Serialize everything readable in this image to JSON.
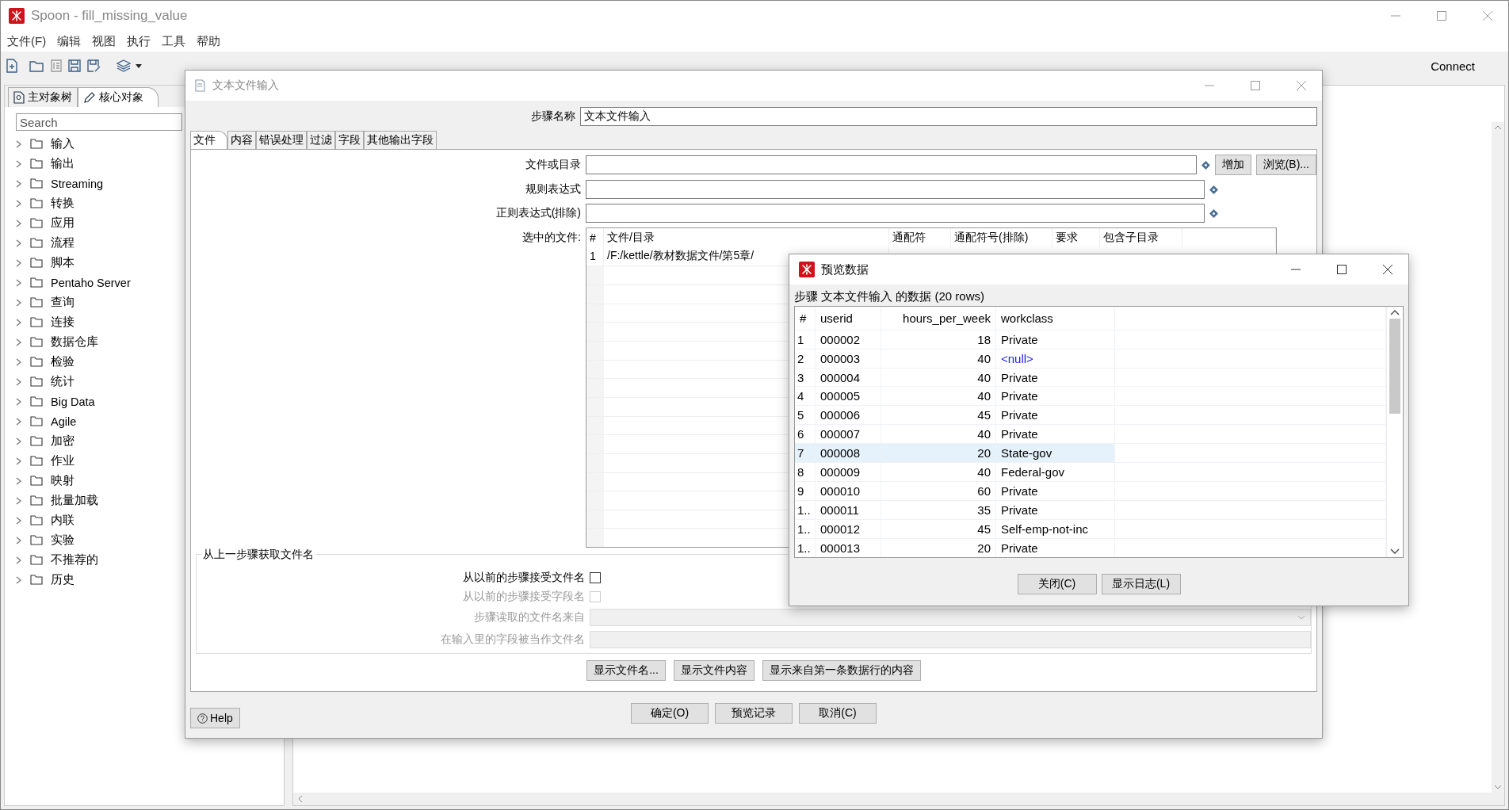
{
  "window": {
    "title": "Spoon - fill_missing_value"
  },
  "menu": [
    "文件(F)",
    "编辑",
    "视图",
    "执行",
    "工具",
    "帮助"
  ],
  "toolbar": {
    "connect": "Connect"
  },
  "left_panel": {
    "tabs": [
      {
        "label": "主对象树",
        "selected": false
      },
      {
        "label": "核心对象",
        "selected": true
      }
    ],
    "search": {
      "placeholder": "Search"
    },
    "tree": [
      {
        "label": "输入",
        "expanded": false
      },
      {
        "label": "输出",
        "expanded": false
      },
      {
        "label": "Streaming",
        "expanded": false
      },
      {
        "label": "转换",
        "expanded": false
      },
      {
        "label": "应用",
        "expanded": false
      },
      {
        "label": "流程",
        "expanded": false
      },
      {
        "label": "脚本",
        "expanded": false
      },
      {
        "label": "Pentaho Server",
        "expanded": false
      },
      {
        "label": "查询",
        "expanded": false
      },
      {
        "label": "连接",
        "expanded": false
      },
      {
        "label": "数据仓库",
        "expanded": false
      },
      {
        "label": "检验",
        "expanded": false
      },
      {
        "label": "统计",
        "expanded": false
      },
      {
        "label": "Big Data",
        "expanded": false
      },
      {
        "label": "Agile",
        "expanded": false
      },
      {
        "label": "加密",
        "expanded": false
      },
      {
        "label": "作业",
        "expanded": false
      },
      {
        "label": "映射",
        "expanded": false
      },
      {
        "label": "批量加载",
        "expanded": false
      },
      {
        "label": "内联",
        "expanded": false
      },
      {
        "label": "实验",
        "expanded": false
      },
      {
        "label": "不推荐的",
        "expanded": false
      },
      {
        "label": "历史",
        "expanded": false
      }
    ]
  },
  "dialog": {
    "title": "文本文件输入",
    "step_name": {
      "label": "步骤名称",
      "value": "文本文件输入"
    },
    "tabs": [
      {
        "label": "文件",
        "selected": true
      },
      {
        "label": "内容",
        "selected": false
      },
      {
        "label": "错误处理",
        "selected": false
      },
      {
        "label": "过滤",
        "selected": false
      },
      {
        "label": "字段",
        "selected": false
      },
      {
        "label": "其他输出字段",
        "selected": false
      }
    ],
    "file_fields": [
      {
        "label": "文件或目录"
      },
      {
        "label": "规则表达式"
      },
      {
        "label": "正则表达式(排除)"
      }
    ],
    "file_buttons": [
      "增加",
      "浏览(B)..."
    ],
    "selected_files": {
      "label": "选中的文件:",
      "columns": [
        "#",
        "文件/目录",
        "通配符",
        "通配符号(排除)",
        "要求",
        "包含子目录"
      ],
      "rows": [
        {
          "number": "1",
          "path": "/F:/kettle/教材数据文件/第5章/"
        }
      ]
    },
    "group": {
      "title": "从上一步骤获取文件名",
      "rows": [
        {
          "kind": "checkbox",
          "label": "从以前的步骤接受文件名",
          "checked": false,
          "disabled": false
        },
        {
          "kind": "checkbox",
          "label": "从以前的步骤接受字段名",
          "checked": false,
          "disabled": true
        },
        {
          "kind": "dropdown",
          "label": "步骤读取的文件名来自",
          "disabled": true
        },
        {
          "kind": "text",
          "label": "在输入里的字段被当作文件名",
          "disabled": true
        }
      ]
    },
    "show_buttons": [
      "显示文件名...",
      "显示文件内容",
      "显示来自第一条数据行的内容"
    ],
    "buttons": [
      "确定(O)",
      "预览记录",
      "取消(C)"
    ],
    "help": "Help"
  },
  "preview": {
    "title": "预览数据",
    "caption": "步骤 文本文件输入 的数据  (20 rows)",
    "columns": [
      "#",
      "userid",
      "hours_per_week",
      "workclass"
    ],
    "rows": [
      {
        "number": "1",
        "userid": "000002",
        "hours": "18",
        "workclass": "Private",
        "is_null": false,
        "selected": false
      },
      {
        "number": "2",
        "userid": "000003",
        "hours": "40",
        "workclass": "<null>",
        "is_null": true,
        "selected": false
      },
      {
        "number": "3",
        "userid": "000004",
        "hours": "40",
        "workclass": "Private",
        "is_null": false,
        "selected": false
      },
      {
        "number": "4",
        "userid": "000005",
        "hours": "40",
        "workclass": "Private",
        "is_null": false,
        "selected": false
      },
      {
        "number": "5",
        "userid": "000006",
        "hours": "45",
        "workclass": "Private",
        "is_null": false,
        "selected": false
      },
      {
        "number": "6",
        "userid": "000007",
        "hours": "40",
        "workclass": "Private",
        "is_null": false,
        "selected": false
      },
      {
        "number": "7",
        "userid": "000008",
        "hours": "20",
        "workclass": "State-gov",
        "is_null": false,
        "selected": true
      },
      {
        "number": "8",
        "userid": "000009",
        "hours": "40",
        "workclass": "Federal-gov",
        "is_null": false,
        "selected": false
      },
      {
        "number": "9",
        "userid": "000010",
        "hours": "60",
        "workclass": "Private",
        "is_null": false,
        "selected": false
      },
      {
        "number": "1..",
        "userid": "000011",
        "hours": "35",
        "workclass": "Private",
        "is_null": false,
        "selected": false
      },
      {
        "number": "1..",
        "userid": "000012",
        "hours": "45",
        "workclass": "Self-emp-not-inc",
        "is_null": false,
        "selected": false
      },
      {
        "number": "1..",
        "userid": "000013",
        "hours": "20",
        "workclass": "Private",
        "is_null": false,
        "selected": false
      }
    ],
    "buttons": [
      "关闭(C)",
      "显示日志(L)"
    ]
  }
}
